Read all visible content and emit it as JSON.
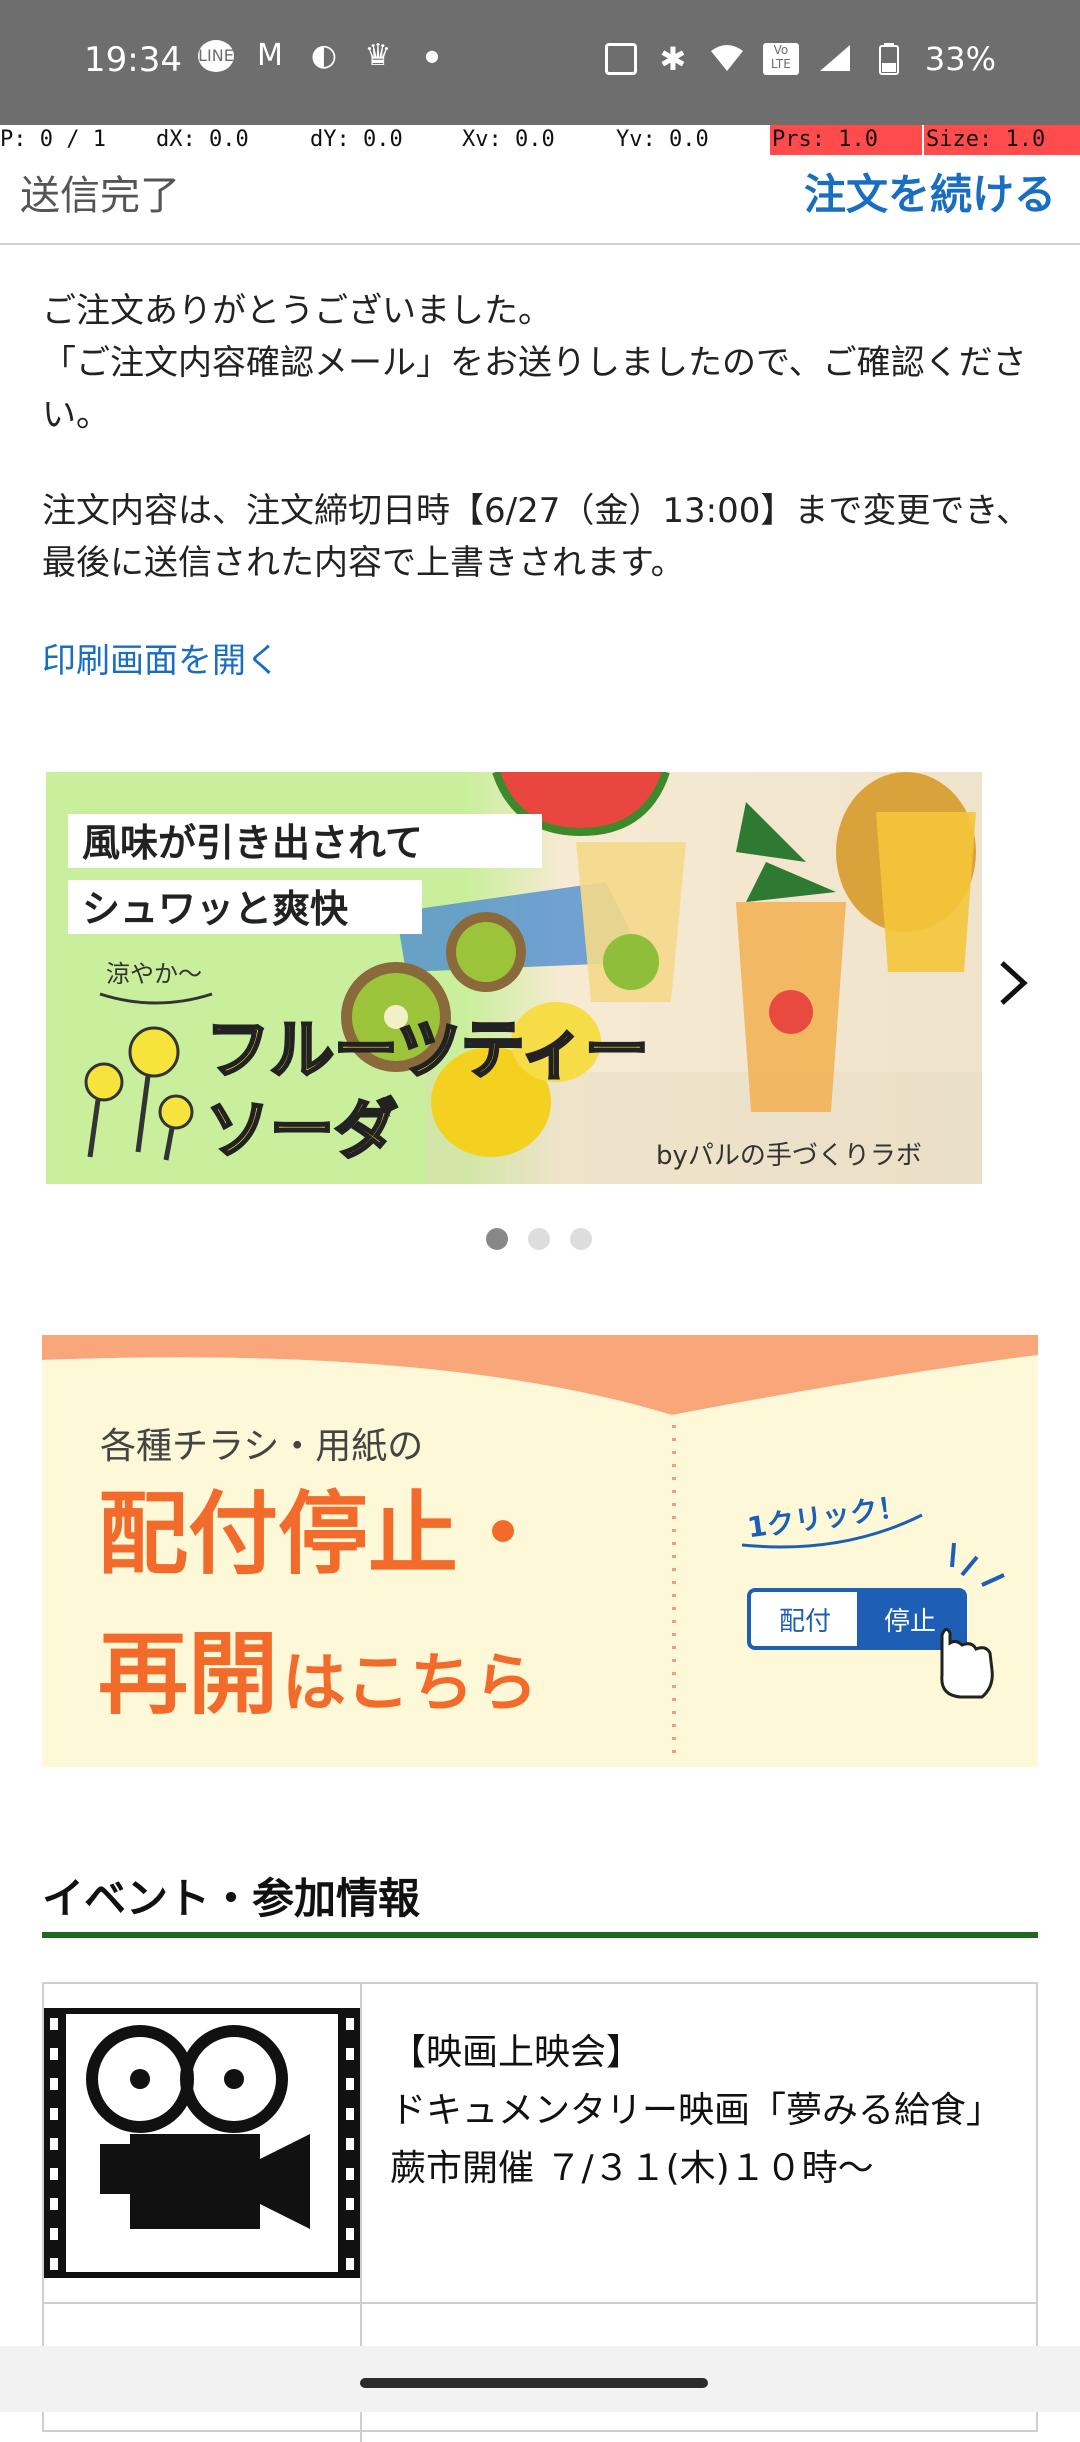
{
  "status": {
    "time": "19:34",
    "battery": "33%",
    "left_icons": [
      "LINE",
      "M",
      "◐",
      "🏆",
      "•"
    ],
    "right_icons": [
      "NFC",
      "✱",
      "wifi",
      "VoLTE",
      "signal",
      "battery"
    ]
  },
  "pointer_overlay": {
    "p": "P: 0 / 1",
    "dx": "dX: 0.0",
    "dy": "dY: 0.0",
    "xv": "Xv: 0.0",
    "yv": "Yv: 0.0",
    "prs": "Prs: 1.0",
    "size": "Size: 1.0"
  },
  "header": {
    "title": "送信完了",
    "continue_label": "注文を続ける"
  },
  "message": {
    "line1": "ご注文ありがとうございました。",
    "line2": "「ご注文内容確認メール」をお送りしましたので、ご確認ください。",
    "line3": "注文内容は、注文締切日時【6/27（金）13:00】まで変更でき、最後に送信された内容で上書きされます。",
    "print_link": "印刷画面を開く"
  },
  "banner1": {
    "line1": "風味が引き出されて",
    "line2": "シュワッと爽快",
    "tag": "涼やか〜",
    "title1": "フルーツティー",
    "title2": "ソーダ",
    "credit": "byパルの手づくりラボ"
  },
  "carousel": {
    "active_index": 0,
    "count": 3
  },
  "banner2": {
    "small": "各種チラシ・用紙の",
    "big1": "配付停止・",
    "big2a": "再開",
    "big2b": "はこちら",
    "oneclick": "1クリック！",
    "btn1": "配付",
    "btn2": "停止"
  },
  "section": {
    "title": "イベント・参加情報"
  },
  "events": [
    {
      "line1": "【映画上映会】",
      "line2": "ドキュメンタリー映画「夢みる給食」",
      "line3": "蕨市開催 ７/３１(木)１０時〜"
    }
  ],
  "colors": {
    "accent": "#1a6ec2",
    "section_rule": "#1d6b1d",
    "banner2_orange": "#f26b2a"
  }
}
